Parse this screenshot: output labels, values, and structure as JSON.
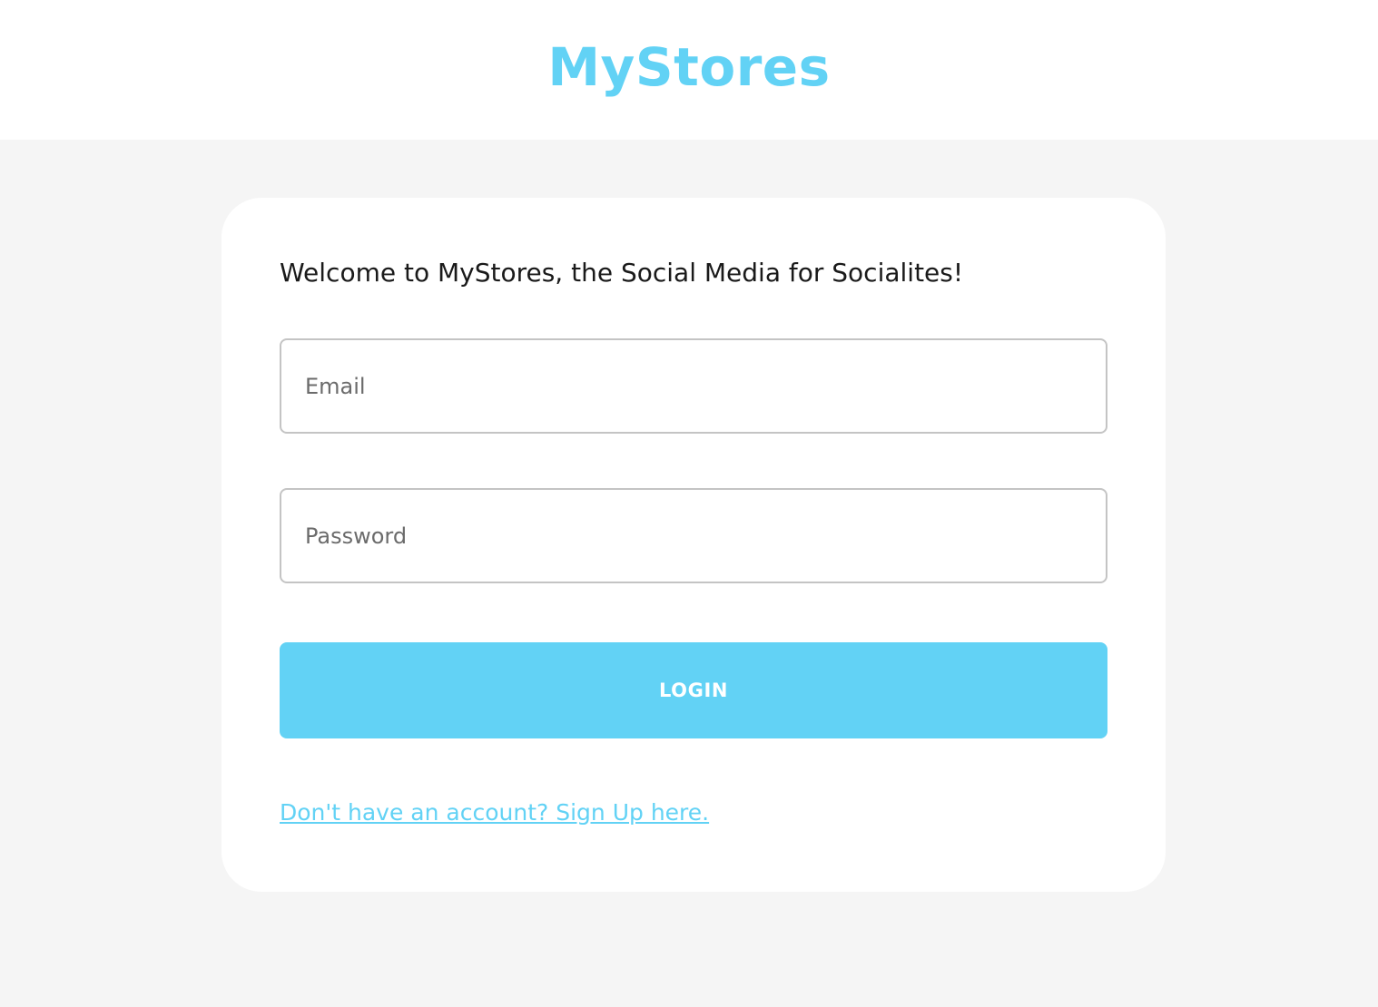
{
  "header": {
    "brand": "MyStores"
  },
  "login_card": {
    "welcome_text": "Welcome to MyStores, the Social Media for Socialites!",
    "email_placeholder": "Email",
    "email_value": "",
    "password_placeholder": "Password",
    "password_value": "",
    "login_label": "LOGIN",
    "signup_link": "Don't have an account? Sign Up here."
  },
  "colors": {
    "accent": "#62d2f5",
    "page_background": "#f5f5f5",
    "card_background": "#ffffff",
    "text_primary": "#1a1a1a",
    "field_border": "#c4c4c4"
  }
}
